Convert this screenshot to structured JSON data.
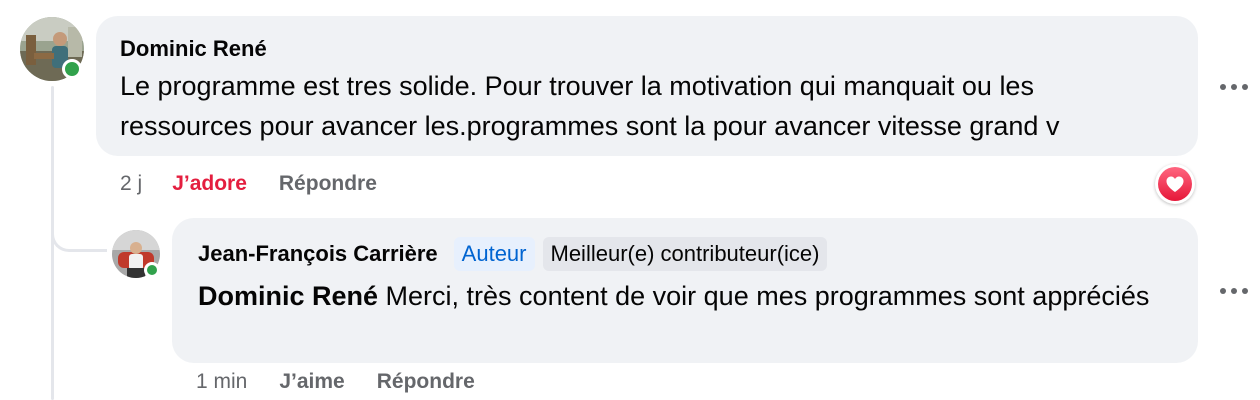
{
  "comment": {
    "author": "Dominic René",
    "text_line1": "Le programme est tres solide. Pour trouver la motivation qui manquait ou les",
    "text_line2": "ressources pour avancer les.programmes sont la pour avancer vitesse grand v",
    "time": "2 j",
    "reaction_label": "J’adore",
    "reply_label": "Répondre",
    "avatar_icon": "user-photo-avatar",
    "reaction_icon": "love-heart-icon",
    "more_icon": "more-options-icon"
  },
  "reply": {
    "author": "Jean-François Carrière",
    "badge_author": "Auteur",
    "badge_top_contributor": "Meilleur(e) contributeur(ice)",
    "mention": "Dominic René",
    "text": " Merci, très content de voir que mes programmes sont appréciés",
    "time": "1 min",
    "like_label": "J’aime",
    "reply_label": "Répondre",
    "avatar_icon": "user-photo-avatar",
    "more_icon": "more-options-icon"
  },
  "colors": {
    "bubble": "#f0f2f5",
    "text": "#050505",
    "muted": "#65676b",
    "love": "#e41e3f",
    "author_badge": "#0064d1",
    "online": "#31a24c"
  }
}
